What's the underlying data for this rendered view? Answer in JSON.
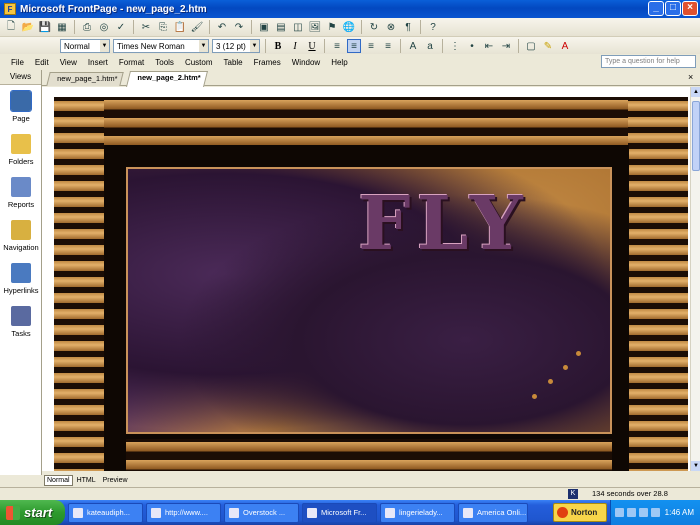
{
  "window": {
    "title": "Microsoft FrontPage - new_page_2.htm"
  },
  "toolbar2": {
    "style": "Normal",
    "font": "Times New Roman",
    "size": "3 (12 pt)"
  },
  "menu": {
    "items": [
      "File",
      "Edit",
      "View",
      "Insert",
      "Format",
      "Tools",
      "Custom",
      "Table",
      "Frames",
      "Window",
      "Help"
    ],
    "help_placeholder": "Type a question for help"
  },
  "views": {
    "header": "Views",
    "items": [
      "Page",
      "Folders",
      "Reports",
      "Navigation",
      "Hyperlinks",
      "Tasks"
    ]
  },
  "tabs": [
    "new_page_1.htm*",
    "new_page_2.htm*"
  ],
  "page": {
    "graphic_text": "FLY"
  },
  "modes": [
    "Normal",
    "HTML",
    "Preview"
  ],
  "status": {
    "text": "134 seconds over 28.8"
  },
  "taskbar": {
    "start": "start",
    "tasks": [
      "kateaudiph...",
      "http://www....",
      "Overstock ...",
      "Microsoft Fr...",
      "lingerielady...",
      "America Onli..."
    ],
    "norton": "Norton",
    "clock": "1:46 AM"
  },
  "colors": {
    "titlebar": "#0348c0",
    "taskbar": "#245edb",
    "start": "#2d9a2d"
  }
}
